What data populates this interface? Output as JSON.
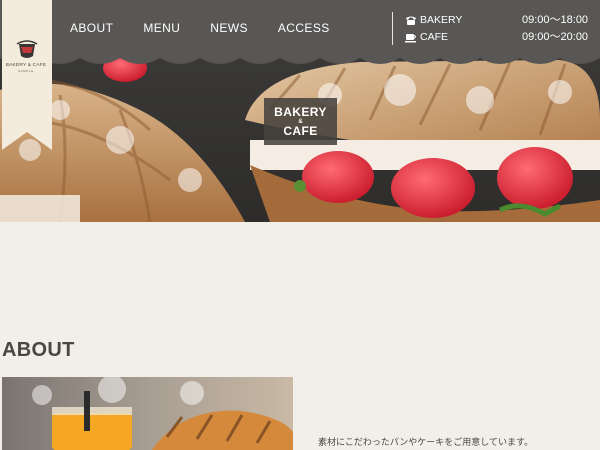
{
  "header": {
    "nav": [
      {
        "label": "ABOUT"
      },
      {
        "label": "MENU"
      },
      {
        "label": "NEWS"
      },
      {
        "label": "ACCESS"
      }
    ],
    "contact": [
      {
        "icon": "phone-icon",
        "label": "BAKERY",
        "hours": "09:00〜18:00"
      },
      {
        "icon": "coffee-cup-icon",
        "label": "CAFE",
        "hours": "09:00〜20:00"
      }
    ],
    "colors": {
      "bar": "#595755",
      "logo_tab": "#f3ecdc",
      "accent": "#c23a3a"
    }
  },
  "logo": {
    "text": "BAKERY & CAFE",
    "subtext": "SAMPLE"
  },
  "hero": {
    "line1": "BAKERY",
    "amp": "&",
    "line2": "CAFE"
  },
  "about": {
    "heading": "ABOUT",
    "description": "素材にこだわったパンやケーキをご用意しています。"
  }
}
